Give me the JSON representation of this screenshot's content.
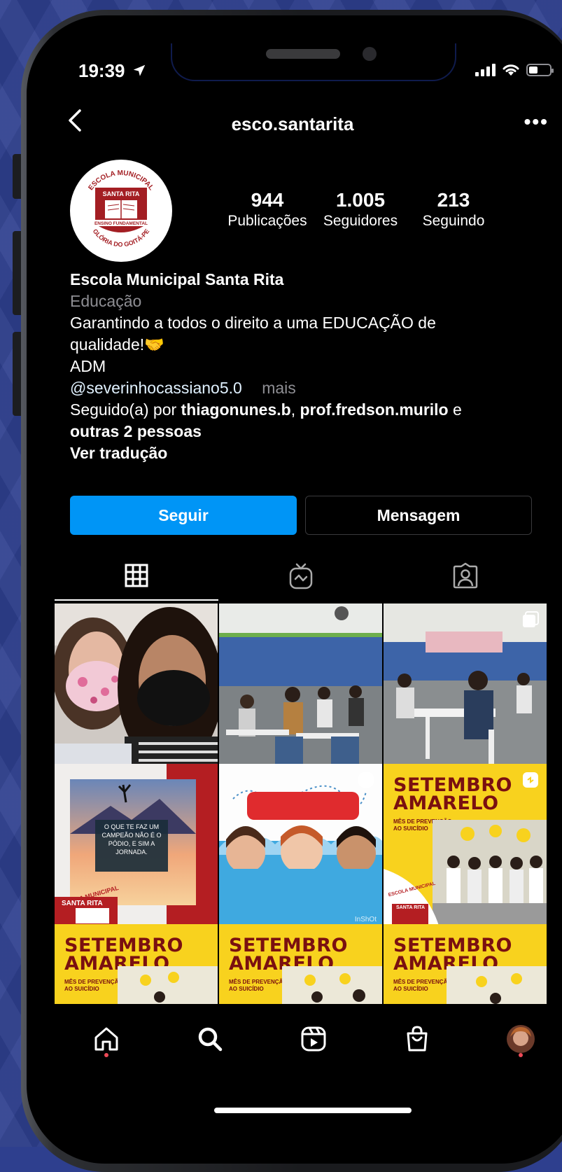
{
  "status_bar": {
    "time": "19:39"
  },
  "header": {
    "username": "esco.santarita"
  },
  "avatar": {
    "line1": "ESCOLA MUNICIPAL",
    "line2": "SANTA RITA",
    "line3": "ENSINO FUNDAMENTAL",
    "line4": "GLÓRIA DO GOITÁ-PE"
  },
  "stats": [
    {
      "value": "944",
      "label": "Publicações"
    },
    {
      "value": "1.005",
      "label": "Seguidores"
    },
    {
      "value": "213",
      "label": "Seguindo"
    }
  ],
  "bio": {
    "name": "Escola Municipal Santa Rita",
    "category": "Educação",
    "line1": "Garantindo a todos o direito a uma EDUCAÇÃO de",
    "line2": "qualidade!🤝",
    "line3": "ADM",
    "mention": "@severinhocassiano5.0",
    "more": "mais",
    "followed_prefix": "Seguido(a) por ",
    "follower1": "thiagonunes.b",
    "separator": ", ",
    "follower2": "prof.fredson.murilo",
    "conj": " e",
    "others": "outras 2 pessoas",
    "translate": "Ver tradução"
  },
  "buttons": {
    "follow": "Seguir",
    "message": "Mensagem"
  },
  "posts": {
    "quote_text": "O QUE TE FAZ UM CAMPEÃO NÃO É O PÓDIO, E SIM A JORNADA.",
    "quote_badge_top": "ESCOLA MUNICIPAL",
    "quote_badge": "SANTA RITA",
    "inshot": "InShOt",
    "setembro_1": "SETEMBRO",
    "setembro_2": "AMARELO",
    "setembro_sub_1": "MÊS DE PREVENÇÃO",
    "setembro_sub_2": "AO SUICÍDIO",
    "post6_badge_top": "ESCOLA MUNICIPAL",
    "post6_badge": "SANTA RITA"
  },
  "colors": {
    "follow_button": "#0095f6",
    "notification_dot": "#ed4956",
    "setembro_yellow": "#f8d21e"
  }
}
